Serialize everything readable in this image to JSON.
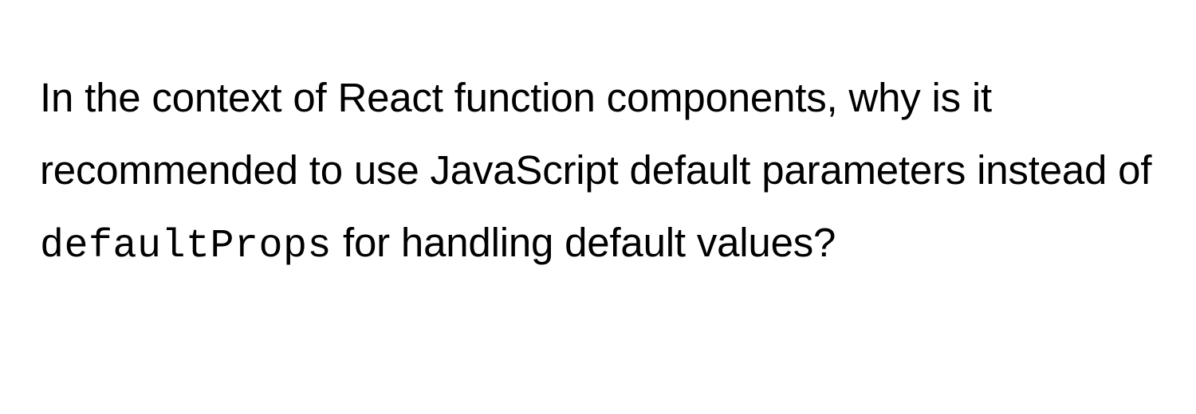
{
  "question": {
    "part1": "In the context of React function components, why is it recommended to use JavaScript default parameters instead of ",
    "code": "defaultProps",
    "part2": " for handling default values?"
  }
}
